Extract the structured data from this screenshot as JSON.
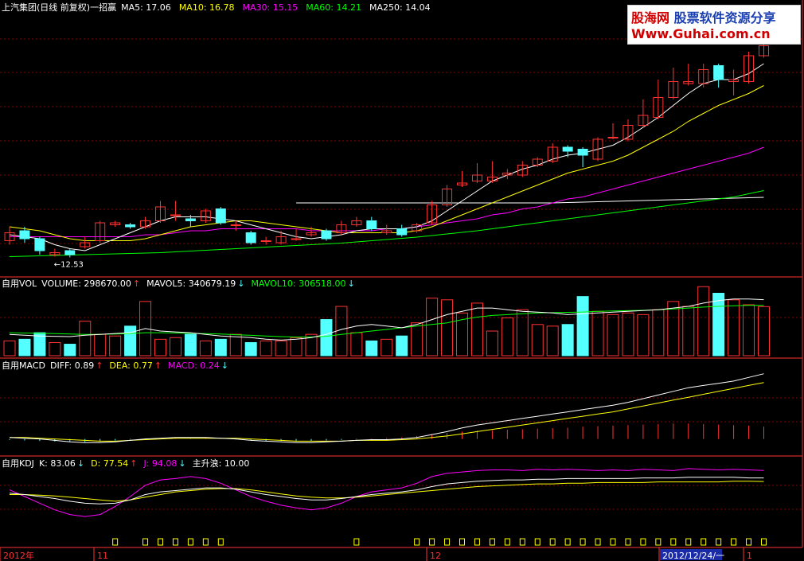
{
  "watermark": {
    "brand": "股海网",
    "slogan": "股票软件资源分享",
    "url": "Www.Guhai.com.cn"
  },
  "colors": {
    "up": "#ff3232",
    "down": "#54ffff",
    "white": "#ffffff",
    "yellow": "#ffff00",
    "magenta": "#ff00ff",
    "green": "#00ff00",
    "grid": "#8b0000",
    "axis": "#ff3232"
  },
  "chart_data": [
    {
      "type": "candlestick",
      "panel": "price",
      "title": "上汽集团(日线 前复权)一招赢",
      "indicators": [
        {
          "name": "MA5",
          "label": "MA5: 17.06",
          "color": "#ffffff"
        },
        {
          "name": "MA10",
          "label": "MA10: 16.78",
          "color": "#ffff00"
        },
        {
          "name": "MA30",
          "label": "MA30: 15.15",
          "color": "#ff00ff"
        },
        {
          "name": "MA60",
          "label": "MA60: 14.21",
          "color": "#00ff00"
        },
        {
          "name": "MA250",
          "label": "MA250: 14.04",
          "color": "#ffffff"
        }
      ],
      "annotation": "←12.53",
      "ylim": [
        12.2,
        18.6
      ],
      "candles": [
        {
          "o": 12.95,
          "c": 13.15,
          "h": 13.3,
          "l": 12.85
        },
        {
          "o": 13.2,
          "c": 13.0,
          "h": 13.3,
          "l": 12.9
        },
        {
          "o": 13.0,
          "c": 12.7,
          "h": 13.05,
          "l": 12.6
        },
        {
          "o": 12.6,
          "c": 12.65,
          "h": 12.75,
          "l": 12.55
        },
        {
          "o": 12.7,
          "c": 12.6,
          "h": 12.75,
          "l": 12.53
        },
        {
          "o": 12.8,
          "c": 12.9,
          "h": 13.05,
          "l": 12.75
        },
        {
          "o": 12.95,
          "c": 13.4,
          "h": 13.45,
          "l": 12.9
        },
        {
          "o": 13.35,
          "c": 13.4,
          "h": 13.45,
          "l": 13.3
        },
        {
          "o": 13.35,
          "c": 13.3,
          "h": 13.4,
          "l": 13.25
        },
        {
          "o": 13.3,
          "c": 13.45,
          "h": 13.55,
          "l": 13.25
        },
        {
          "o": 13.45,
          "c": 13.8,
          "h": 13.95,
          "l": 13.4
        },
        {
          "o": 13.6,
          "c": 13.6,
          "h": 13.95,
          "l": 13.45
        },
        {
          "o": 13.5,
          "c": 13.45,
          "h": 13.6,
          "l": 13.3
        },
        {
          "o": 13.45,
          "c": 13.7,
          "h": 13.75,
          "l": 13.4
        },
        {
          "o": 13.75,
          "c": 13.4,
          "h": 13.8,
          "l": 13.35
        },
        {
          "o": 13.35,
          "c": 13.35,
          "h": 13.45,
          "l": 13.2
        },
        {
          "o": 13.15,
          "c": 12.9,
          "h": 13.2,
          "l": 12.85
        },
        {
          "o": 12.95,
          "c": 12.95,
          "h": 13.05,
          "l": 12.85
        },
        {
          "o": 12.9,
          "c": 13.05,
          "h": 13.2,
          "l": 12.85
        },
        {
          "o": 13.0,
          "c": 13.0,
          "h": 13.25,
          "l": 12.95
        },
        {
          "o": 13.1,
          "c": 13.15,
          "h": 13.3,
          "l": 13.05
        },
        {
          "o": 13.2,
          "c": 13.0,
          "h": 13.25,
          "l": 12.95
        },
        {
          "o": 13.15,
          "c": 13.35,
          "h": 13.45,
          "l": 13.1
        },
        {
          "o": 13.35,
          "c": 13.45,
          "h": 13.55,
          "l": 13.3
        },
        {
          "o": 13.45,
          "c": 13.25,
          "h": 13.55,
          "l": 13.2
        },
        {
          "o": 13.15,
          "c": 13.2,
          "h": 13.35,
          "l": 13.1
        },
        {
          "o": 13.25,
          "c": 13.1,
          "h": 13.35,
          "l": 13.05
        },
        {
          "o": 13.2,
          "c": 13.35,
          "h": 13.4,
          "l": 13.15
        },
        {
          "o": 13.4,
          "c": 13.85,
          "h": 13.95,
          "l": 13.35
        },
        {
          "o": 13.85,
          "c": 14.25,
          "h": 14.35,
          "l": 13.8
        },
        {
          "o": 14.35,
          "c": 14.4,
          "h": 14.7,
          "l": 14.3
        },
        {
          "o": 14.45,
          "c": 14.6,
          "h": 14.9,
          "l": 14.4
        },
        {
          "o": 14.45,
          "c": 14.55,
          "h": 14.95,
          "l": 14.4
        },
        {
          "o": 14.6,
          "c": 14.65,
          "h": 14.75,
          "l": 14.5
        },
        {
          "o": 14.6,
          "c": 14.85,
          "h": 14.95,
          "l": 14.55
        },
        {
          "o": 14.85,
          "c": 15.0,
          "h": 15.05,
          "l": 14.8
        },
        {
          "o": 14.95,
          "c": 15.3,
          "h": 15.4,
          "l": 14.9
        },
        {
          "o": 15.3,
          "c": 15.2,
          "h": 15.35,
          "l": 15.05
        },
        {
          "o": 15.25,
          "c": 15.1,
          "h": 15.3,
          "l": 14.8
        },
        {
          "o": 15.0,
          "c": 15.5,
          "h": 15.55,
          "l": 14.95
        },
        {
          "o": 15.55,
          "c": 15.55,
          "h": 15.9,
          "l": 15.5
        },
        {
          "o": 15.5,
          "c": 15.85,
          "h": 16.0,
          "l": 15.45
        },
        {
          "o": 15.85,
          "c": 16.1,
          "h": 16.5,
          "l": 15.8
        },
        {
          "o": 16.05,
          "c": 16.55,
          "h": 17.0,
          "l": 16.0
        },
        {
          "o": 16.55,
          "c": 16.95,
          "h": 17.3,
          "l": 16.5
        },
        {
          "o": 16.9,
          "c": 16.95,
          "h": 17.4,
          "l": 16.85
        },
        {
          "o": 16.9,
          "c": 17.25,
          "h": 17.4,
          "l": 16.8
        },
        {
          "o": 17.35,
          "c": 17.0,
          "h": 17.4,
          "l": 16.8
        },
        {
          "o": 16.95,
          "c": 17.0,
          "h": 17.25,
          "l": 16.6
        },
        {
          "o": 16.95,
          "c": 17.6,
          "h": 17.7,
          "l": 16.9
        },
        {
          "o": 17.6,
          "c": 17.85,
          "h": 18.3,
          "l": 17.55
        }
      ],
      "ma5": [
        13.1,
        13.05,
        13.0,
        12.85,
        12.75,
        12.7,
        12.85,
        13.0,
        13.15,
        13.3,
        13.45,
        13.55,
        13.55,
        13.55,
        13.5,
        13.45,
        13.35,
        13.25,
        13.15,
        13.05,
        13.0,
        13.05,
        13.1,
        13.2,
        13.25,
        13.25,
        13.25,
        13.3,
        13.45,
        13.7,
        13.95,
        14.2,
        14.45,
        14.6,
        14.75,
        14.85,
        15.0,
        15.1,
        15.15,
        15.25,
        15.35,
        15.55,
        15.8,
        16.05,
        16.35,
        16.65,
        16.9,
        17.0,
        17.0,
        17.15,
        17.4
      ],
      "ma10": [
        13.3,
        13.25,
        13.2,
        13.1,
        13.0,
        12.95,
        12.95,
        12.95,
        12.95,
        13.0,
        13.1,
        13.2,
        13.3,
        13.35,
        13.4,
        13.45,
        13.45,
        13.4,
        13.35,
        13.3,
        13.25,
        13.2,
        13.15,
        13.15,
        13.15,
        13.15,
        13.15,
        13.2,
        13.3,
        13.45,
        13.6,
        13.75,
        13.9,
        14.05,
        14.2,
        14.35,
        14.5,
        14.65,
        14.75,
        14.85,
        14.95,
        15.1,
        15.3,
        15.5,
        15.7,
        15.95,
        16.15,
        16.35,
        16.5,
        16.65,
        16.85
      ],
      "ma30": [
        13.05,
        13.05,
        13.05,
        13.05,
        13.05,
        13.05,
        13.05,
        13.05,
        13.05,
        13.1,
        13.1,
        13.15,
        13.2,
        13.2,
        13.25,
        13.25,
        13.25,
        13.25,
        13.25,
        13.25,
        13.2,
        13.2,
        13.2,
        13.2,
        13.2,
        13.25,
        13.25,
        13.3,
        13.35,
        13.4,
        13.45,
        13.5,
        13.6,
        13.65,
        13.75,
        13.8,
        13.9,
        14.0,
        14.05,
        14.15,
        14.25,
        14.35,
        14.45,
        14.55,
        14.65,
        14.75,
        14.85,
        14.95,
        15.05,
        15.15,
        15.3
      ],
      "ma60": [
        12.55,
        12.56,
        12.57,
        12.58,
        12.59,
        12.6,
        12.61,
        12.62,
        12.63,
        12.64,
        12.65,
        12.67,
        12.69,
        12.71,
        12.73,
        12.75,
        12.77,
        12.79,
        12.81,
        12.83,
        12.85,
        12.87,
        12.89,
        12.92,
        12.95,
        12.98,
        13.01,
        13.04,
        13.08,
        13.12,
        13.16,
        13.2,
        13.25,
        13.3,
        13.35,
        13.4,
        13.45,
        13.5,
        13.55,
        13.6,
        13.65,
        13.7,
        13.75,
        13.8,
        13.85,
        13.9,
        13.95,
        14.0,
        14.05,
        14.13,
        14.21
      ],
      "ma250": [
        null,
        null,
        null,
        null,
        null,
        null,
        null,
        null,
        null,
        null,
        null,
        null,
        null,
        null,
        null,
        null,
        null,
        null,
        null,
        13.9,
        13.9,
        13.9,
        13.9,
        13.9,
        13.9,
        13.9,
        13.9,
        13.9,
        13.9,
        13.9,
        13.9,
        13.9,
        13.9,
        13.9,
        13.9,
        13.9,
        13.9,
        13.91,
        13.92,
        13.93,
        13.94,
        13.95,
        13.96,
        13.97,
        13.98,
        13.99,
        14.0,
        14.01,
        14.02,
        14.03,
        14.04
      ]
    },
    {
      "type": "bar",
      "panel": "volume",
      "title": "自用VOL",
      "indicators": [
        {
          "name": "VOLUME",
          "label": "VOLUME: 298670.00",
          "color": "#ffffff",
          "arrow": "up"
        },
        {
          "name": "MAVOL5",
          "label": "MAVOL5: 340679.19",
          "color": "#ffffff",
          "arrow": "down"
        },
        {
          "name": "MAVOL10",
          "label": "MAVOL10: 306518.00",
          "color": "#00ff00",
          "arrow": "down"
        }
      ],
      "ylim": [
        0,
        460000
      ],
      "values": [
        90000,
        100000,
        140000,
        80000,
        70000,
        210000,
        130000,
        120000,
        180000,
        330000,
        100000,
        110000,
        130000,
        90000,
        100000,
        130000,
        80000,
        90000,
        90000,
        110000,
        130000,
        220000,
        300000,
        140000,
        90000,
        100000,
        120000,
        200000,
        350000,
        340000,
        260000,
        320000,
        150000,
        230000,
        280000,
        190000,
        180000,
        190000,
        360000,
        270000,
        250000,
        260000,
        250000,
        280000,
        330000,
        300000,
        420000,
        380000,
        340000,
        310000,
        298670
      ],
      "mavol5": [
        130000,
        125000,
        120000,
        118000,
        116000,
        125000,
        130000,
        135000,
        140000,
        165000,
        150000,
        145000,
        140000,
        130000,
        120000,
        115000,
        110000,
        100000,
        95000,
        100000,
        110000,
        130000,
        160000,
        180000,
        190000,
        180000,
        170000,
        190000,
        220000,
        250000,
        270000,
        290000,
        290000,
        280000,
        270000,
        265000,
        260000,
        250000,
        255000,
        260000,
        265000,
        270000,
        275000,
        280000,
        290000,
        300000,
        320000,
        335000,
        345000,
        345000,
        340679
      ],
      "mavol10": [
        140000,
        138000,
        136000,
        134000,
        132000,
        130000,
        130000,
        132000,
        134000,
        140000,
        140000,
        138000,
        136000,
        134000,
        132000,
        128000,
        124000,
        120000,
        116000,
        114000,
        114000,
        118000,
        130000,
        140000,
        150000,
        160000,
        170000,
        180000,
        190000,
        200000,
        220000,
        235000,
        245000,
        250000,
        255000,
        260000,
        262000,
        264000,
        266000,
        270000,
        272000,
        274000,
        276000,
        280000,
        284000,
        290000,
        296000,
        300000,
        304000,
        306000,
        306518
      ]
    },
    {
      "type": "line",
      "panel": "macd",
      "title": "自用MACD",
      "indicators": [
        {
          "name": "DIFF",
          "label": "DIFF: 0.89",
          "color": "#ffffff",
          "arrow": "up"
        },
        {
          "name": "DEA",
          "label": "DEA: 0.77",
          "color": "#ffff00",
          "arrow": "up"
        },
        {
          "name": "MACD",
          "label": "MACD: 0.24",
          "color": "#ff00ff",
          "arrow": "down"
        }
      ],
      "ylim": [
        -0.2,
        1.05
      ],
      "diff": [
        0.02,
        0.01,
        0.0,
        -0.02,
        -0.04,
        -0.05,
        -0.05,
        -0.04,
        -0.02,
        0.0,
        0.01,
        0.02,
        0.02,
        0.02,
        0.01,
        0.0,
        -0.02,
        -0.03,
        -0.04,
        -0.05,
        -0.05,
        -0.04,
        -0.03,
        -0.02,
        -0.01,
        -0.01,
        0.0,
        0.02,
        0.06,
        0.1,
        0.15,
        0.19,
        0.22,
        0.25,
        0.28,
        0.31,
        0.34,
        0.37,
        0.4,
        0.43,
        0.46,
        0.5,
        0.55,
        0.6,
        0.65,
        0.7,
        0.73,
        0.76,
        0.79,
        0.84,
        0.89
      ],
      "dea": [
        0.02,
        0.02,
        0.01,
        0.0,
        -0.01,
        -0.02,
        -0.03,
        -0.03,
        -0.02,
        -0.01,
        0.0,
        0.01,
        0.01,
        0.01,
        0.01,
        0.01,
        0.0,
        -0.01,
        -0.02,
        -0.03,
        -0.03,
        -0.03,
        -0.03,
        -0.02,
        -0.02,
        -0.02,
        -0.01,
        0.0,
        0.02,
        0.04,
        0.07,
        0.1,
        0.13,
        0.16,
        0.19,
        0.22,
        0.25,
        0.28,
        0.31,
        0.34,
        0.37,
        0.41,
        0.45,
        0.49,
        0.53,
        0.57,
        0.61,
        0.65,
        0.69,
        0.73,
        0.77
      ],
      "macd": [
        -0.02,
        -0.03,
        -0.04,
        -0.05,
        -0.06,
        -0.06,
        -0.05,
        -0.03,
        -0.01,
        0.01,
        0.02,
        0.02,
        0.02,
        0.02,
        0.01,
        -0.01,
        -0.03,
        -0.04,
        -0.04,
        -0.04,
        -0.04,
        -0.03,
        -0.02,
        -0.01,
        0.01,
        0.02,
        0.03,
        0.06,
        0.09,
        0.12,
        0.14,
        0.16,
        0.17,
        0.18,
        0.19,
        0.2,
        0.21,
        0.22,
        0.24,
        0.25,
        0.26,
        0.27,
        0.28,
        0.29,
        0.3,
        0.3,
        0.29,
        0.28,
        0.27,
        0.26,
        0.24
      ]
    },
    {
      "type": "line",
      "panel": "kdj",
      "title": "自用KDJ",
      "indicators": [
        {
          "name": "K",
          "label": "K: 83.06",
          "color": "#ffffff",
          "arrow": "down"
        },
        {
          "name": "D",
          "label": "D: 77.54",
          "color": "#ffff00",
          "arrow": "up"
        },
        {
          "name": "J",
          "label": "J: 94.08",
          "color": "#ff00ff",
          "arrow": "down"
        },
        {
          "name": "主升浪",
          "label": "主升浪: 10.00",
          "color": "#ffffff"
        }
      ],
      "ylim": [
        0,
        110
      ],
      "k": [
        60,
        58,
        55,
        52,
        48,
        45,
        44,
        45,
        50,
        58,
        62,
        64,
        66,
        68,
        68,
        66,
        62,
        58,
        55,
        52,
        50,
        50,
        52,
        55,
        58,
        60,
        62,
        65,
        70,
        74,
        76,
        78,
        79,
        80,
        80,
        81,
        81,
        82,
        82,
        82,
        82,
        82,
        83,
        83,
        83,
        84,
        84,
        84,
        84,
        83,
        83
      ],
      "d": [
        58,
        58,
        57,
        56,
        54,
        52,
        50,
        48,
        50,
        54,
        58,
        62,
        64,
        66,
        67,
        67,
        65,
        62,
        59,
        56,
        54,
        53,
        53,
        54,
        56,
        58,
        60,
        62,
        64,
        66,
        68,
        70,
        71,
        72,
        73,
        74,
        74,
        75,
        75,
        76,
        76,
        76,
        76,
        77,
        77,
        77,
        77,
        77,
        78,
        78,
        77.54
      ],
      "j": [
        65,
        55,
        45,
        35,
        28,
        25,
        28,
        40,
        55,
        72,
        80,
        82,
        85,
        82,
        75,
        65,
        55,
        48,
        42,
        38,
        35,
        38,
        45,
        55,
        62,
        65,
        68,
        75,
        85,
        90,
        92,
        94,
        95,
        95,
        94,
        96,
        95,
        96,
        95,
        94,
        95,
        94,
        96,
        95,
        94,
        97,
        96,
        95,
        96,
        95,
        94.08
      ],
      "signals": [
        0,
        0,
        0,
        0,
        0,
        0,
        0,
        1,
        0,
        1,
        1,
        1,
        1,
        1,
        1,
        0,
        0,
        0,
        0,
        0,
        0,
        0,
        0,
        1,
        0,
        0,
        0,
        1,
        1,
        1,
        1,
        1,
        1,
        1,
        1,
        1,
        1,
        1,
        1,
        1,
        1,
        1,
        1,
        1,
        1,
        1,
        1,
        1,
        1,
        1,
        1
      ]
    }
  ],
  "time_axis": {
    "labels": [
      "2012年",
      "11",
      "12",
      "2012/12/24/一",
      "1"
    ]
  }
}
